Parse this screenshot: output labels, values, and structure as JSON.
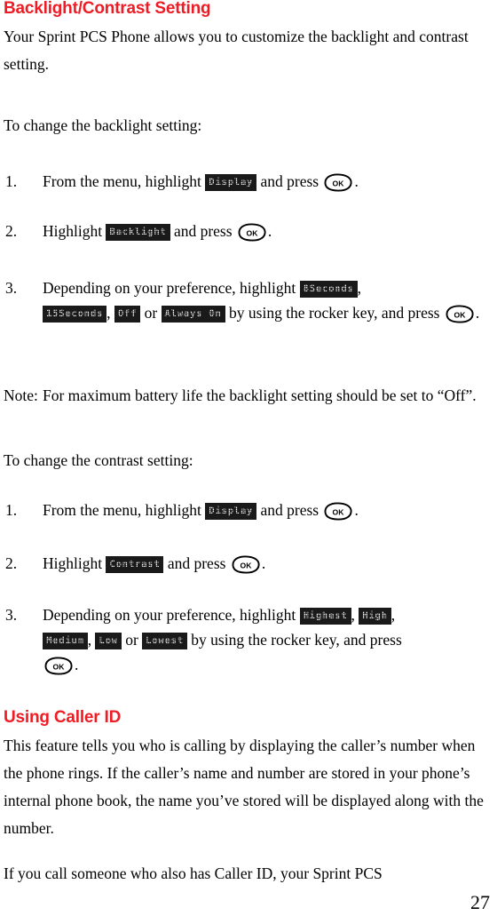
{
  "page": {
    "folio": "27"
  },
  "sections": {
    "backlight": {
      "heading": "Backlight/Contrast Setting",
      "intro": "Your Sprint PCS Phone allows you to customize the backlight and contrast setting.",
      "backlight_lead": "To change the backlight setting:",
      "steps": [
        {
          "num": "1.",
          "text_before": "From  the menu, highlight",
          "chip1": "Display",
          "text_mid": "and press",
          "key": "OK",
          "text_after": "."
        },
        {
          "num": "2.",
          "text_before": "Highlight",
          "chip1": "Backlight",
          "text_mid": "and press",
          "key": "OK",
          "text_after": "."
        },
        {
          "num": "3.",
          "text_before": "Depending on your preference, highlight",
          "chip1": "8Seconds",
          "sep1": ",",
          "chip2": "15Seconds",
          "sep2": ",",
          "chip3": "Off",
          "conj": "or",
          "chip4": "Always On",
          "text_mid": "by using the rocker key, and press",
          "key": "OK",
          "text_after": "."
        }
      ],
      "note_label": "Note:",
      "note_text": "For maximum battery life the backlight setting should be set to “Off”.",
      "contrast_lead": "To change the contrast setting:",
      "contrast_steps": [
        {
          "num": "1.",
          "text_before": "From  the menu, highlight",
          "chip1": "Display",
          "text_mid": "and press",
          "key": "OK",
          "text_after": "."
        },
        {
          "num": "2.",
          "text_before": "Highlight",
          "chip1": "Contrast",
          "text_mid": "and press",
          "key": "OK",
          "text_after": "."
        },
        {
          "num": "3.",
          "text_before": "Depending on your preference, highlight",
          "chip1": "Highest",
          "sep1": ",",
          "chip2": "High",
          "sep2": ",",
          "chip3": "Medium",
          "sep3": ",",
          "chip4": "Low",
          "conj": "or",
          "chip5": "Lowest",
          "text_mid": "by using the rocker key, and press",
          "key": "OK",
          "text_after": "."
        }
      ]
    },
    "caller_id": {
      "heading": "Using Caller ID",
      "para1": "This feature tells you who is calling by displaying the caller’s number when the phone rings. If the caller’s name and number are stored in your phone’s internal phone book, the name you’ve stored will be displayed along with the number.",
      "para2": "If you call someone who also has Caller ID, your Sprint PCS"
    }
  },
  "colors": {
    "heading_red": "#ee1c25",
    "lcd_background": "#1a1a1a",
    "lcd_text": "#ffffff",
    "body_text": "#000000"
  },
  "icons": {
    "ok_key": "ok-key-icon"
  }
}
